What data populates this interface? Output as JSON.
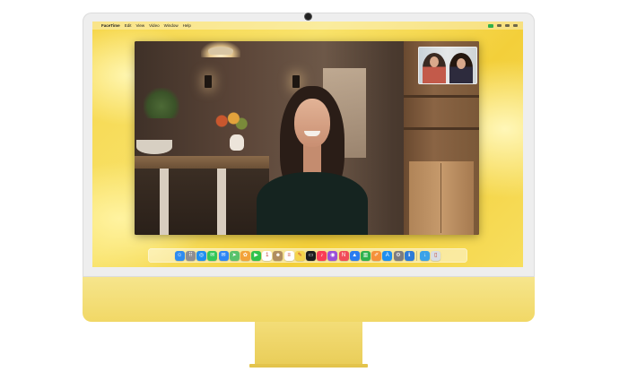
{
  "menubar": {
    "app_name": "FaceTime",
    "items": [
      "Edit",
      "View",
      "Video",
      "Window",
      "Help"
    ]
  },
  "dock": {
    "apps": [
      {
        "name": "finder-icon",
        "color": "#2f8cf0",
        "glyph": "☺"
      },
      {
        "name": "launchpad-icon",
        "color": "#8e8e93",
        "glyph": "⠿"
      },
      {
        "name": "safari-icon",
        "color": "#1f8ef1",
        "glyph": "◎"
      },
      {
        "name": "messages-icon",
        "color": "#34c759",
        "glyph": "✉"
      },
      {
        "name": "mail-icon",
        "color": "#2e86f5",
        "glyph": "✉"
      },
      {
        "name": "maps-icon",
        "color": "#5ac26b",
        "glyph": "➤"
      },
      {
        "name": "photos-icon",
        "color": "#f2a33a",
        "glyph": "✿"
      },
      {
        "name": "facetime-icon",
        "color": "#30c24b",
        "glyph": "▶"
      },
      {
        "name": "calendar-icon",
        "color": "#ffffff",
        "glyph": "1"
      },
      {
        "name": "contacts-icon",
        "color": "#b08e60",
        "glyph": "☻"
      },
      {
        "name": "reminders-icon",
        "color": "#ffffff",
        "glyph": "≡"
      },
      {
        "name": "notes-icon",
        "color": "#f6d44b",
        "glyph": "✎"
      },
      {
        "name": "tv-icon",
        "color": "#1c1c1e",
        "glyph": "▭"
      },
      {
        "name": "music-icon",
        "color": "#fa3c55",
        "glyph": "♪"
      },
      {
        "name": "podcasts-icon",
        "color": "#9b4fd9",
        "glyph": "◉"
      },
      {
        "name": "news-icon",
        "color": "#f14b58",
        "glyph": "N"
      },
      {
        "name": "keynote-icon",
        "color": "#2a7cf0",
        "glyph": "▲"
      },
      {
        "name": "numbers-icon",
        "color": "#2fb24e",
        "glyph": "▥"
      },
      {
        "name": "pages-icon",
        "color": "#f5913a",
        "glyph": "✐"
      },
      {
        "name": "app-store-icon",
        "color": "#1e8ff0",
        "glyph": "A"
      },
      {
        "name": "system-preferences-icon",
        "color": "#7c7c80",
        "glyph": "⚙"
      },
      {
        "name": "accessibility-icon",
        "color": "#2d7bd8",
        "glyph": "ℹ"
      }
    ],
    "trailing": [
      {
        "name": "downloads-folder-icon",
        "color": "#3aa2e8",
        "glyph": "↓"
      },
      {
        "name": "trash-icon",
        "color": "#d9dde2",
        "glyph": "▯"
      }
    ]
  }
}
